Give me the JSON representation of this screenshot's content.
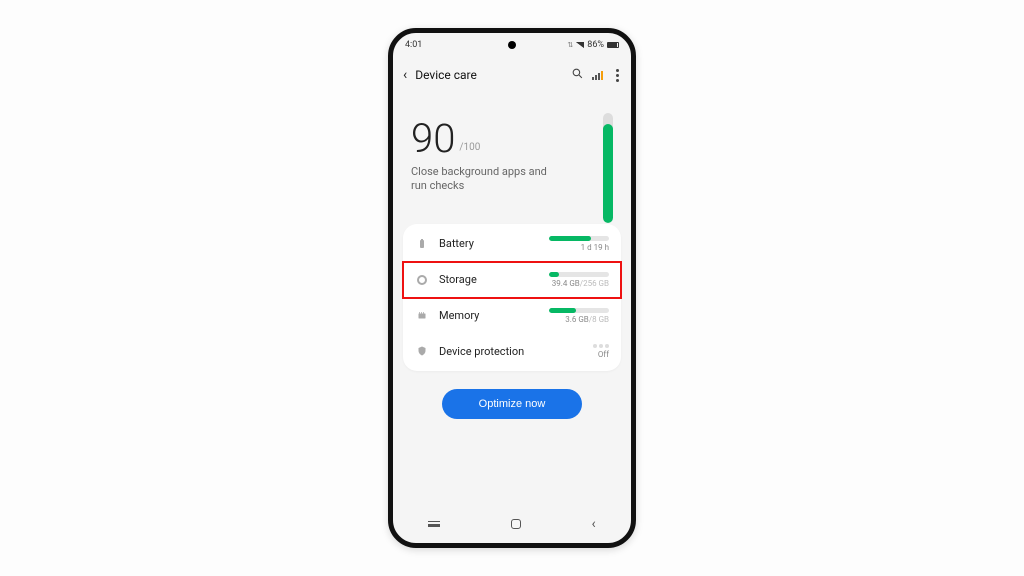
{
  "status": {
    "time": "4:01",
    "battery_pct": "86%"
  },
  "appbar": {
    "title": "Device care"
  },
  "hero": {
    "score": "90",
    "score_max": "/100",
    "subtitle": "Close background apps and run checks",
    "score_fill_pct": 90
  },
  "rows": {
    "battery": {
      "label": "Battery",
      "sub": "1 d 19 h",
      "fill_pct": 70
    },
    "storage": {
      "label": "Storage",
      "used": "39.4 GB",
      "total": "/256 GB",
      "fill_pct": 16
    },
    "memory": {
      "label": "Memory",
      "used": "3.6 GB",
      "total": "/8 GB",
      "fill_pct": 45
    },
    "protection": {
      "label": "Device protection",
      "status": "Off"
    }
  },
  "button": {
    "optimize": "Optimize now"
  }
}
